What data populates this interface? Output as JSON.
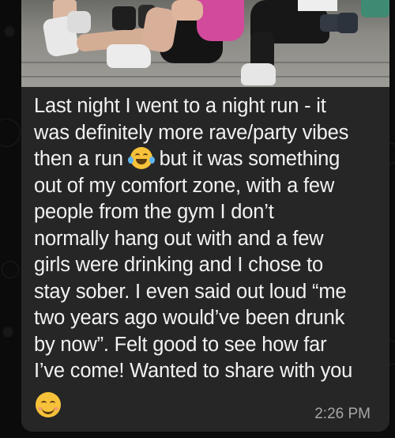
{
  "message": {
    "line1": "Last night I went to a night run - it",
    "line2": "was definitely more rave/party vibes",
    "line3_before_emoji": "then a run ",
    "line3_after_emoji": " but it was something",
    "line4": "out of my comfort zone, with a few",
    "line5": "people from the gym I don’t",
    "line6": "normally hang out with and a few",
    "line7": "girls were drinking and I chose to",
    "line8": "stay sober. I even said out loud “me",
    "line9": "two years ago would’ve been drunk",
    "line10": "by now”. Felt good to see how far",
    "line11": "I’ve come! Wanted to share with you",
    "inline_emoji": "laughing-with-tears-emoji",
    "trailing_emoji": "smiling-face-emoji",
    "timestamp": "2:26 PM"
  },
  "colors": {
    "bubble": "#262626",
    "background": "#0b0b0b",
    "text": "#f2f2f2",
    "timestamp": "#a6a6a6",
    "emoji": "#f7c23a"
  }
}
